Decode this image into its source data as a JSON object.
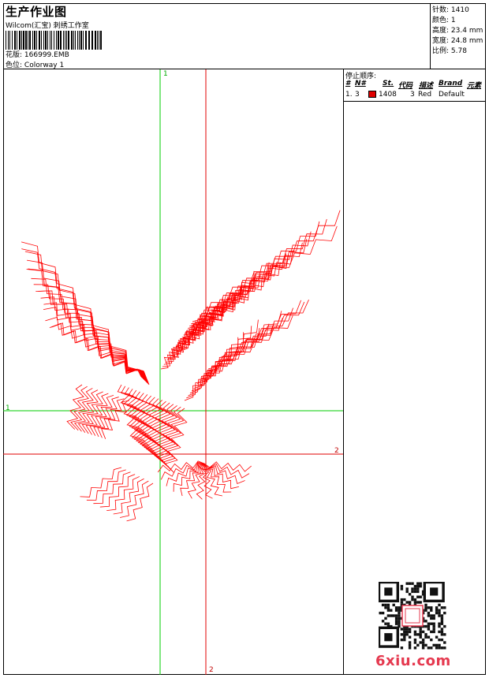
{
  "header": {
    "title": "生产作业图",
    "studio": "Wilcom(汇宝) 刺绣工作室",
    "design_label": "花版:",
    "design_value": "166999.EMB",
    "colorway_label": "色位:",
    "colorway_value": "Colorway 1"
  },
  "stats": [
    {
      "label": "针数:",
      "value": "1410"
    },
    {
      "label": "颜色:",
      "value": "1"
    },
    {
      "label": "高度:",
      "value": "23.4 mm"
    },
    {
      "label": "宽度:",
      "value": "24.8 mm"
    },
    {
      "label": "比例:",
      "value": "5.78"
    }
  ],
  "stop_sequence": {
    "title": "停止顺序:",
    "columns": [
      "#",
      "N#",
      "St.",
      "代码",
      "描述",
      "Brand",
      "元素"
    ],
    "rows": [
      {
        "num": "1.",
        "n": "3",
        "stitches": "1408",
        "code": "3",
        "desc": "Red",
        "brand": "Default",
        "swatch": "#e00000"
      }
    ]
  },
  "axes": {
    "v1": "1",
    "h1": "1",
    "h2": "2",
    "v2": "2"
  },
  "colors": {
    "thread": "#ff0000",
    "green_axis": "#00cc00",
    "red_axis": "#e00000",
    "watermark": "#e5394f"
  },
  "watermark": "6xiu.com"
}
